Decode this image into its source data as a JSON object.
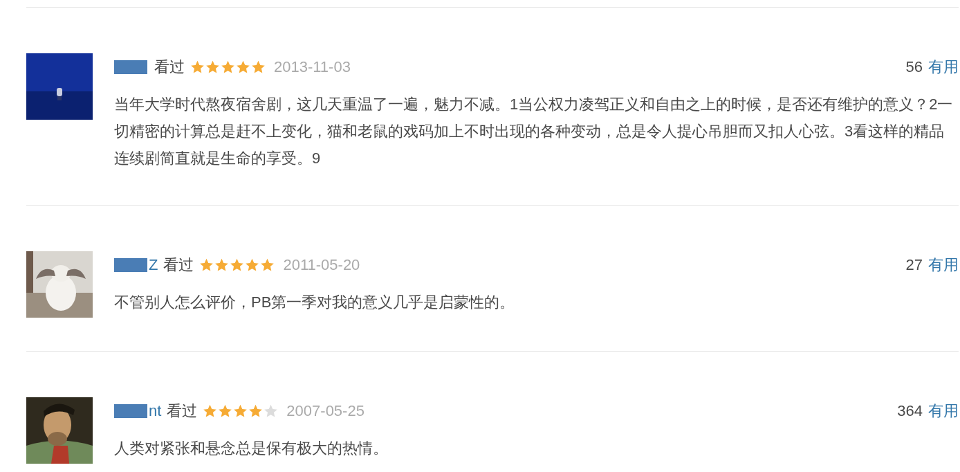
{
  "comments": [
    {
      "status": "看过",
      "stars": 5,
      "date": "2013-11-03",
      "votes": "56",
      "vote_label": "有用",
      "text": "当年大学时代熬夜宿舍剧，这几天重温了一遍，魅力不减。1当公权力凌驾正义和自由之上的时候，是否还有维护的意义？2一切精密的计算总是赶不上变化，猫和老鼠的戏码加上不时出现的各种变动，总是令人提心吊胆而又扣人心弦。3看这样的精品连续剧简直就是生命的享受。9"
    },
    {
      "username_visible": "Z",
      "status": "看过",
      "stars": 5,
      "date": "2011-05-20",
      "votes": "27",
      "vote_label": "有用",
      "text": "不管别人怎么评价，PB第一季对我的意义几乎是启蒙性的。"
    },
    {
      "username_visible": "nt",
      "status": "看过",
      "stars": 4,
      "date": "2007-05-25",
      "votes": "364",
      "vote_label": "有用",
      "text": "人类对紧张和悬念总是保有极大的热情。"
    }
  ]
}
